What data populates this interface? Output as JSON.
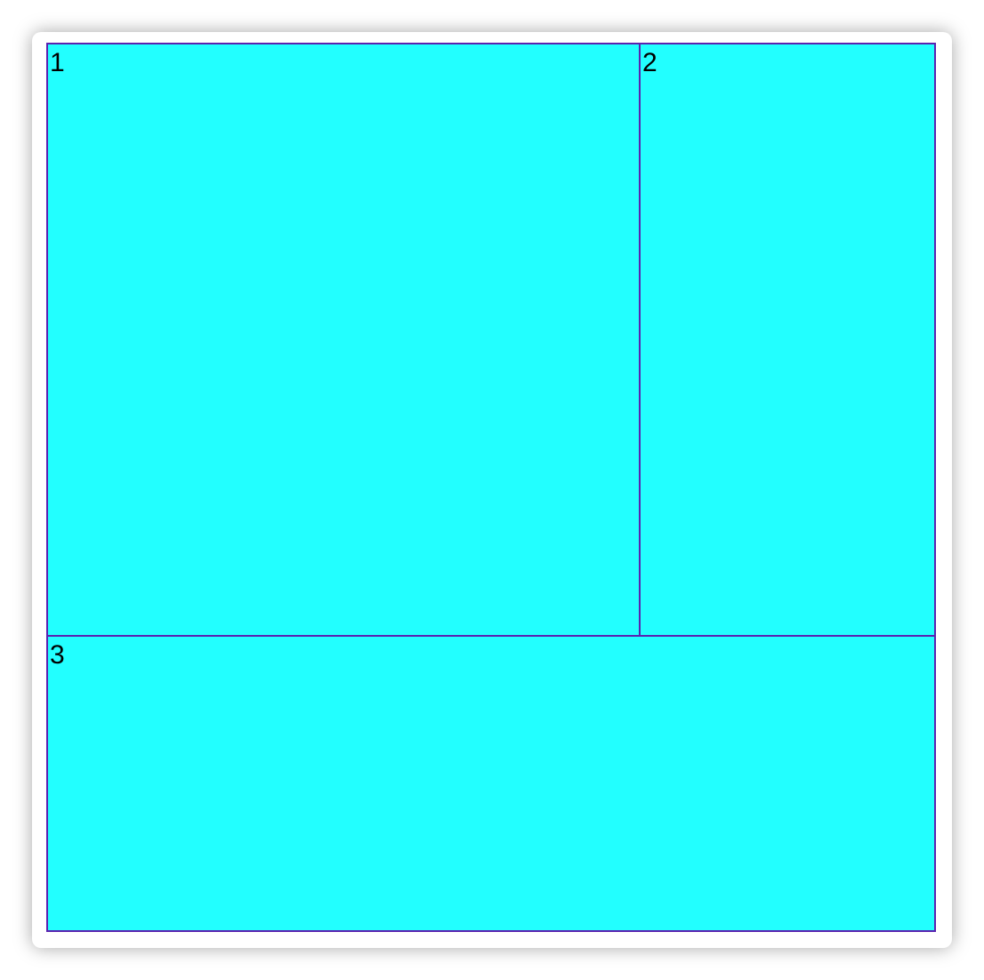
{
  "colors": {
    "cell_fill": "#22ffff",
    "cell_border": "#5a22b0",
    "label_text": "#000000"
  },
  "cells": [
    {
      "label": "1"
    },
    {
      "label": "2"
    },
    {
      "label": "3"
    }
  ]
}
